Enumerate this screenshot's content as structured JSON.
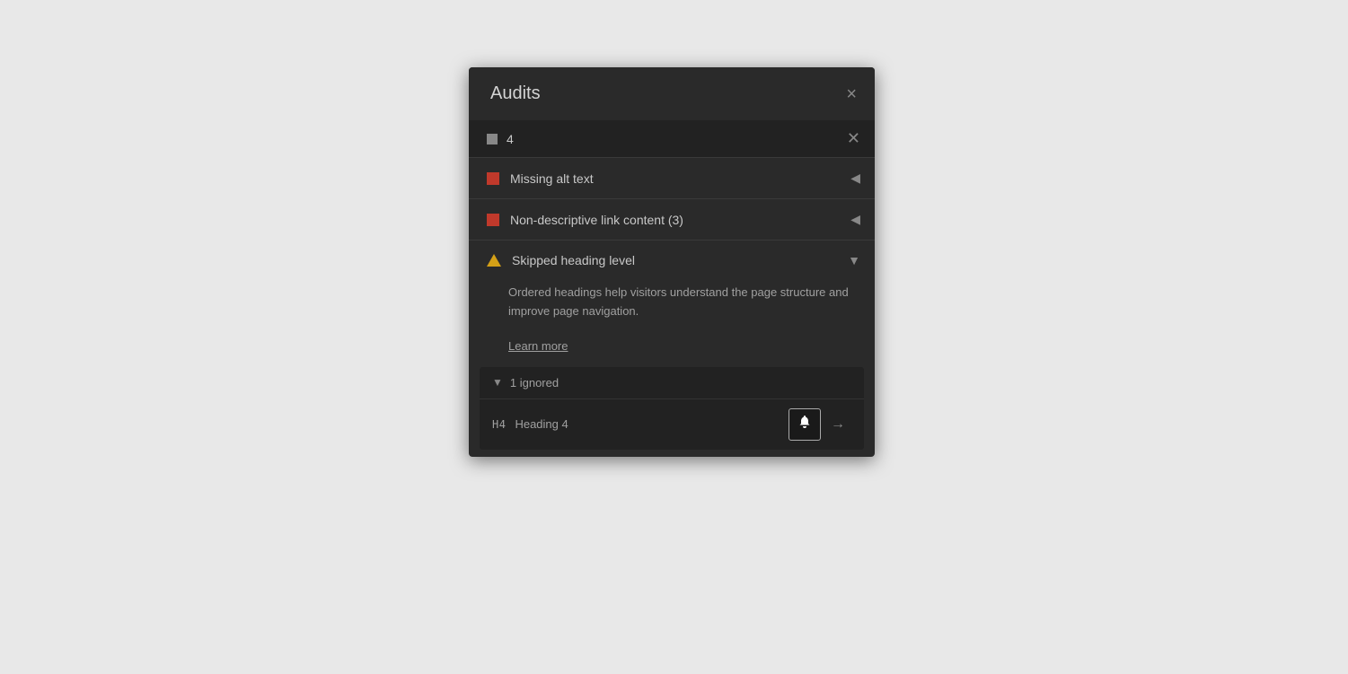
{
  "panel": {
    "title": "Audits",
    "close_label": "×",
    "filter": {
      "count": "4",
      "clear_label": "✕"
    },
    "items": [
      {
        "id": "missing-alt-text",
        "label": "Missing alt text",
        "type": "error",
        "expanded": false,
        "chevron": "◀"
      },
      {
        "id": "non-descriptive-link",
        "label": "Non-descriptive link content (3)",
        "type": "error",
        "expanded": false,
        "chevron": "◀"
      },
      {
        "id": "skipped-heading",
        "label": "Skipped heading level",
        "type": "warning",
        "expanded": true,
        "chevron": "▼",
        "description": "Ordered headings help visitors understand the page structure and improve page navigation.",
        "learn_more": "Learn more",
        "ignored_section": {
          "label": "1 ignored",
          "chevron": "▼",
          "items": [
            {
              "badge": "H4",
              "label": "Heading 4"
            }
          ]
        }
      }
    ]
  },
  "icons": {
    "close": "×",
    "chevron_left": "◀",
    "chevron_down": "▼",
    "bell": "🔔",
    "arrow_right": "→"
  }
}
